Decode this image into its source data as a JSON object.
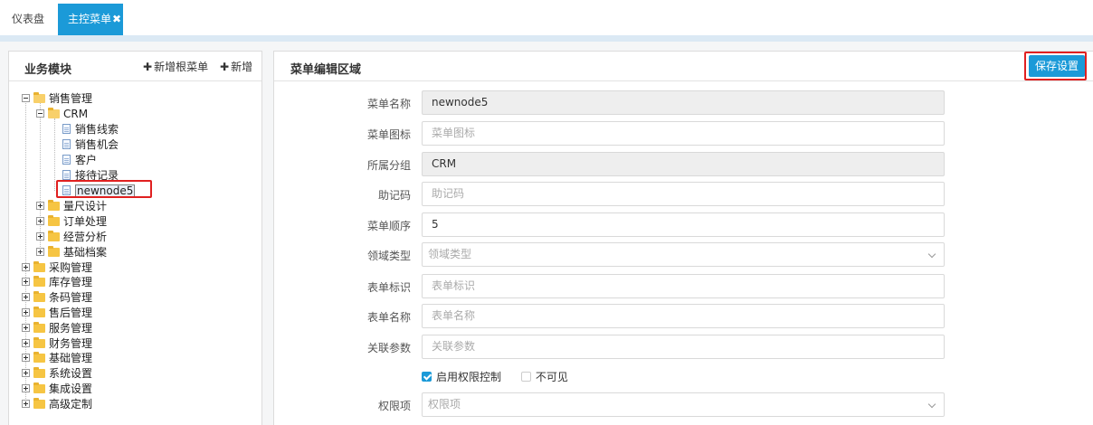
{
  "tabs": {
    "dashboard": "仪表盘",
    "main_menu": "主控菜单",
    "close_glyph": "✖"
  },
  "left_panel": {
    "title": "业务模块",
    "add_root_label": "新增根菜单",
    "add_label": "新增",
    "plus_glyph": "✚"
  },
  "tree": {
    "sales": "销售管理",
    "crm": "CRM",
    "crm_children": [
      "销售线索",
      "销售机会",
      "客户",
      "接待记录",
      "newnode5"
    ],
    "sales_children": [
      "量尺设计",
      "订单处理",
      "经营分析",
      "基础档案"
    ],
    "roots": [
      "采购管理",
      "库存管理",
      "条码管理",
      "售后管理",
      "服务管理",
      "财务管理",
      "基础管理",
      "系统设置",
      "集成设置",
      "高级定制"
    ]
  },
  "right_panel": {
    "title": "菜单编辑区域",
    "save_label": "保存设置",
    "fields": {
      "menu_name": {
        "label": "菜单名称",
        "value": "newnode5"
      },
      "menu_icon": {
        "label": "菜单图标",
        "placeholder": "菜单图标"
      },
      "group": {
        "label": "所属分组",
        "value": "CRM"
      },
      "mnemonic": {
        "label": "助记码",
        "placeholder": "助记码"
      },
      "order": {
        "label": "菜单顺序",
        "value": "5"
      },
      "domain_type": {
        "label": "领域类型",
        "placeholder": "领域类型"
      },
      "form_id": {
        "label": "表单标识",
        "placeholder": "表单标识"
      },
      "form_name": {
        "label": "表单名称",
        "placeholder": "表单名称"
      },
      "params": {
        "label": "关联参数",
        "placeholder": "关联参数"
      },
      "permission": {
        "label": "权限项",
        "placeholder": "权限项"
      }
    },
    "enable_permission_label": "启用权限控制",
    "enable_permission_checked": true,
    "invisible_label": "不可见",
    "invisible_checked": false
  },
  "colors": {
    "accent": "#1b9ad8",
    "highlight": "#e02020"
  }
}
